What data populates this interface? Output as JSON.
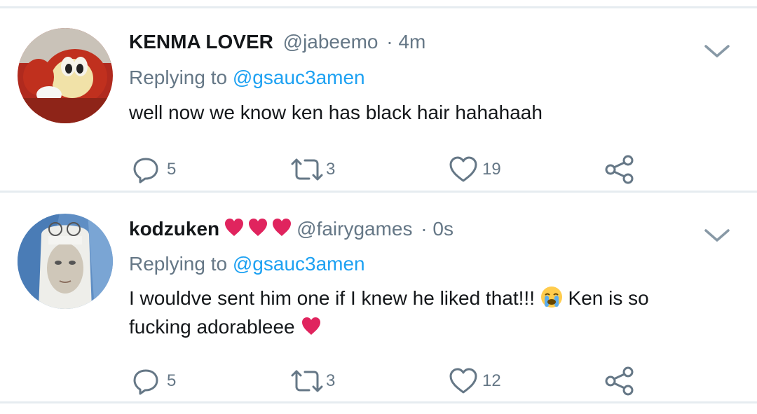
{
  "tweets": [
    {
      "name": "KENMA LOVER",
      "handle": "@jabeemo",
      "separator": "·",
      "time": "4m",
      "replying_prefix": "Replying to",
      "replying_to": "@gsauc3amen",
      "text": "well now we know ken has black hair hahahaah",
      "replies": "5",
      "retweets": "3",
      "likes": "19"
    },
    {
      "name": "kodzuken",
      "name_emoji": "red-heart-x3",
      "handle": "@fairygames",
      "separator": "·",
      "time": "0s",
      "replying_prefix": "Replying to",
      "replying_to": "@gsauc3amen",
      "text_part1": "I wouldve sent him one if I knew he liked that!!!",
      "text_part1_emoji": "crying-face-emoji",
      "text_part2": "Ken is so",
      "text_line2": "fucking adorableee",
      "text_line2_emoji": "red-heart",
      "replies": "5",
      "retweets": "3",
      "likes": "12"
    }
  ],
  "colors": {
    "text": "#14171a",
    "secondary": "#657786",
    "link": "#1da1f2",
    "divider": "#e6ecf0",
    "heart_red": "#e0245e"
  },
  "icons": [
    "reply-icon",
    "retweet-icon",
    "like-icon",
    "share-icon",
    "chevron-down-icon"
  ]
}
